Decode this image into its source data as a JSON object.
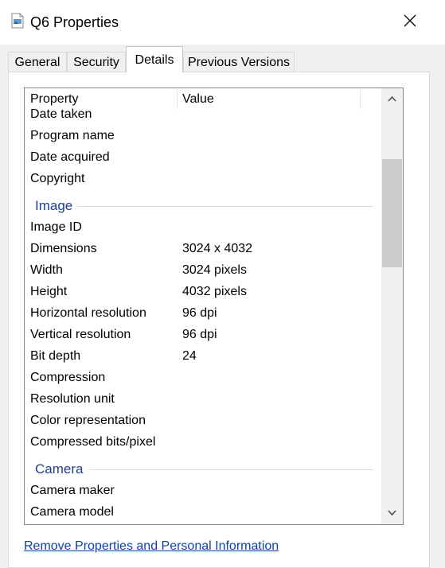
{
  "window": {
    "title": "Q6 Properties"
  },
  "tabs": [
    {
      "label": "General"
    },
    {
      "label": "Security"
    },
    {
      "label": "Details"
    },
    {
      "label": "Previous Versions"
    }
  ],
  "list": {
    "header": {
      "property": "Property",
      "value": "Value"
    },
    "rows_top": [
      {
        "property": "Date taken",
        "value": ""
      },
      {
        "property": "Program name",
        "value": ""
      },
      {
        "property": "Date acquired",
        "value": ""
      },
      {
        "property": "Copyright",
        "value": ""
      }
    ],
    "group_image": "Image",
    "rows_image": [
      {
        "property": "Image ID",
        "value": ""
      },
      {
        "property": "Dimensions",
        "value": "3024 x 4032"
      },
      {
        "property": "Width",
        "value": "3024 pixels"
      },
      {
        "property": "Height",
        "value": "4032 pixels"
      },
      {
        "property": "Horizontal resolution",
        "value": "96 dpi"
      },
      {
        "property": "Vertical resolution",
        "value": "96 dpi"
      },
      {
        "property": "Bit depth",
        "value": "24"
      },
      {
        "property": "Compression",
        "value": ""
      },
      {
        "property": "Resolution unit",
        "value": ""
      },
      {
        "property": "Color representation",
        "value": ""
      },
      {
        "property": "Compressed bits/pixel",
        "value": ""
      }
    ],
    "group_camera": "Camera",
    "rows_camera": [
      {
        "property": "Camera maker",
        "value": ""
      },
      {
        "property": "Camera model",
        "value": ""
      }
    ]
  },
  "footer": {
    "link_label": "Remove Properties and Personal Information"
  }
}
